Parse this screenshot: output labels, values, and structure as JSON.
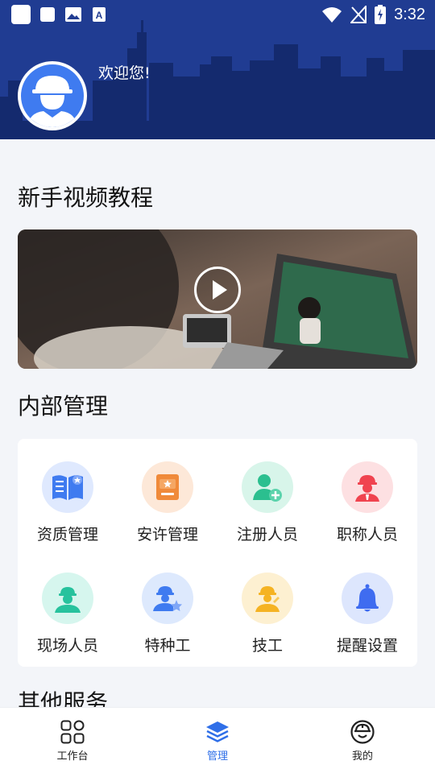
{
  "status_bar": {
    "time": "3:32"
  },
  "header": {
    "welcome": "欢迎您!"
  },
  "sections": {
    "tutorial_title": "新手视频教程",
    "internal_title": "内部管理",
    "other_title": "其他服务"
  },
  "internal_items": [
    {
      "label": "资质管理",
      "icon": "qualification-book-icon",
      "color": "#3f7bf0",
      "bg": "#dfe9fe"
    },
    {
      "label": "安许管理",
      "icon": "safety-permit-icon",
      "color": "#f08a3a",
      "bg": "#fde8d8"
    },
    {
      "label": "注册人员",
      "icon": "register-person-icon",
      "color": "#2bbf8f",
      "bg": "#d8f5ea"
    },
    {
      "label": "职称人员",
      "icon": "title-person-icon",
      "color": "#f0434f",
      "bg": "#fde0e2"
    },
    {
      "label": "现场人员",
      "icon": "site-person-icon",
      "color": "#27c29d",
      "bg": "#d6f6ee"
    },
    {
      "label": "特种工",
      "icon": "special-worker-icon",
      "color": "#3f7bf0",
      "bg": "#dde9fd"
    },
    {
      "label": "技工",
      "icon": "technician-icon",
      "color": "#f5b323",
      "bg": "#fdf0d1"
    },
    {
      "label": "提醒设置",
      "icon": "reminder-bell-icon",
      "color": "#3f6cf0",
      "bg": "#dde6fd"
    }
  ],
  "tabs": [
    {
      "label": "工作台",
      "icon": "workbench-grid-icon"
    },
    {
      "label": "管理",
      "icon": "management-layers-icon"
    },
    {
      "label": "我的",
      "icon": "profile-helmet-icon"
    }
  ],
  "colors": {
    "header_bg": "#1f3a8f",
    "accent": "#2f6fe8"
  }
}
